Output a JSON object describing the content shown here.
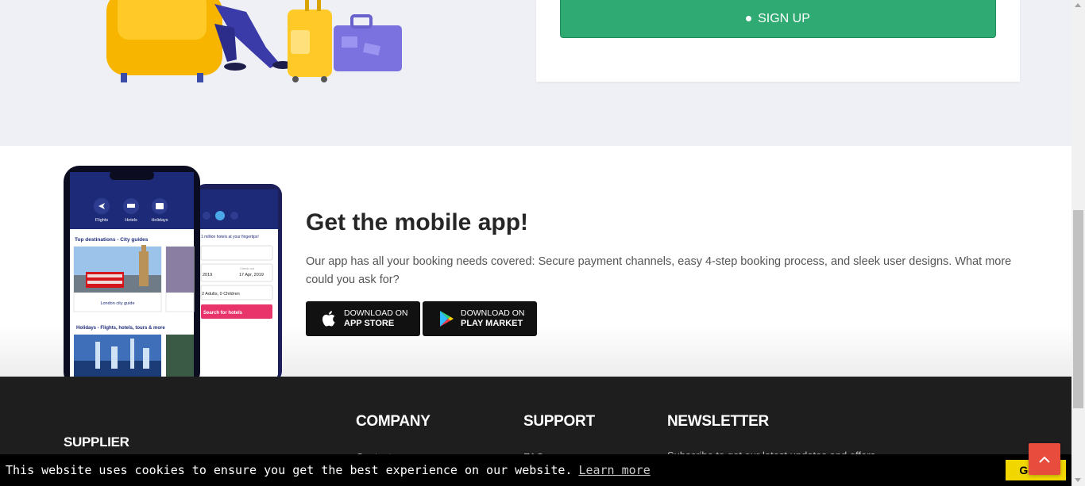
{
  "signup": {
    "label": "SIGN UP"
  },
  "app": {
    "title": "Get the mobile app!",
    "description": "Our app has all your booking needs covered: Secure payment channels, easy 4-step booking process, and sleek user designs. What more could you ask for?",
    "appstore": {
      "small": "DOWNLOAD ON",
      "big": "APP STORE"
    },
    "playmarket": {
      "small": "DOWNLOAD ON",
      "big": "PLAY MARKET"
    }
  },
  "phone_screens": {
    "nav": [
      "Flights",
      "Hotels",
      "Holidays"
    ],
    "top_destinations": "Top destinations - City guides",
    "london": "London city guide",
    "holidays": "Holidays - Flights, hotels, tours & more",
    "hotels_tagline": "1 million hotels at your fingertips!",
    "checkout_label": "Check out",
    "date_left": "2019",
    "date_right": "17 Apr, 2019",
    "guests": "2 Adults, 0 Children",
    "search_button": "Search for hotels"
  },
  "footer": {
    "supplier": "SUPPLIER",
    "company": "COMPANY",
    "support": "SUPPORT",
    "newsletter": "NEWSLETTER",
    "company_link": "Contact us",
    "support_link": "FAQ",
    "newsletter_text": "Subscribe to get our latest updates and offers"
  },
  "cookie": {
    "message": "This website uses cookies to ensure you get the best experience on our website.",
    "learn_more": "Learn more",
    "button": "Got it!"
  },
  "colors": {
    "signup_green": "#2eaa72",
    "footer_bg": "#1e1e1e",
    "cookie_button": "#f1d600",
    "back_to_top": "#e74c3c",
    "phone_navy": "#1c2a78",
    "search_pink": "#e8336b"
  },
  "icons": {
    "back_to_top": "chevron-up-icon",
    "appstore": "apple-icon",
    "playmarket": "google-play-icon"
  }
}
